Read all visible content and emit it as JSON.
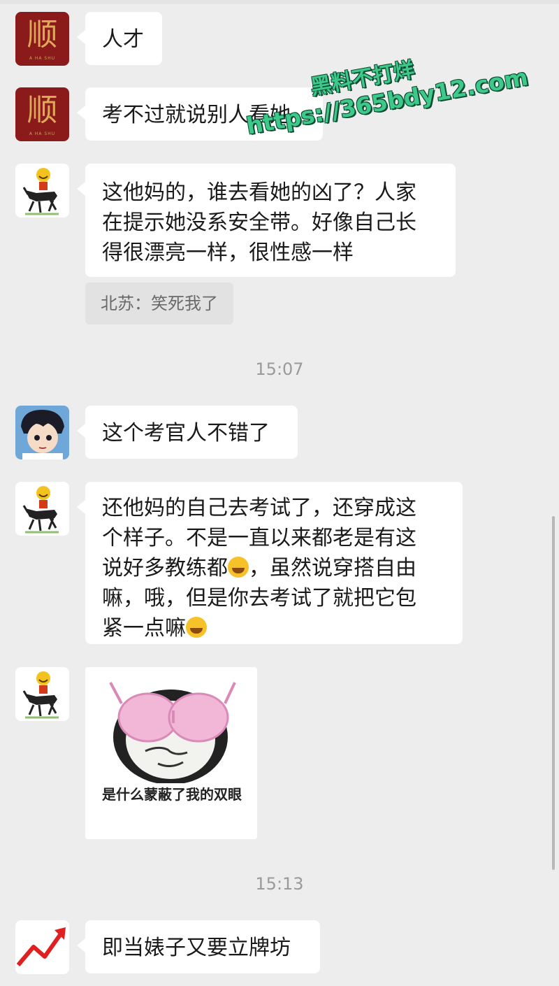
{
  "messages": [
    {
      "sender": "顺",
      "avatar_icon": "shun-logo-icon",
      "text": "人才"
    },
    {
      "sender": "顺",
      "avatar_icon": "shun-logo-icon",
      "text": "考不过就说别人看她"
    },
    {
      "avatar_icon": "donkey-rider-icon",
      "text_lines": [
        "这他妈的，谁去看她的凶了？人家",
        "在提示她没系安全带。好像自己长",
        "得很漂亮一样，很性感一样"
      ],
      "quote": "北苏：笑死我了"
    },
    {
      "avatar_icon": "anime-boy-icon",
      "text": "这个考官人不错了"
    },
    {
      "avatar_icon": "donkey-rider-icon",
      "text_lines": [
        "还他妈的自己去考试了，还穿成这",
        "个样子。不是一直以来都老是有这",
        "说好多教练都",
        "，虽然说穿搭自由",
        "嘛，哦，但是你去考试了就把它包",
        "紧一点嘛"
      ]
    },
    {
      "avatar_icon": "donkey-rider-icon",
      "sticker_caption": "是什么蒙蔽了我的双眼",
      "sticker_icon": "panda-bra-sticker-icon"
    },
    {
      "avatar_icon": "red-arrow-icon",
      "text": "即当婊子又要立牌坊"
    }
  ],
  "timestamps": [
    "15:07",
    "15:13"
  ],
  "watermark": {
    "line1": "黑料不打烊",
    "line2": "https://365bdy12.com"
  },
  "avatar_logo_text": "顺",
  "avatar_logo_small": "A HA SHU",
  "colors": {
    "background": "#ededed",
    "bubble": "#ffffff",
    "quote": "#e2e2e2",
    "shun_red": "#8b1a1a"
  }
}
